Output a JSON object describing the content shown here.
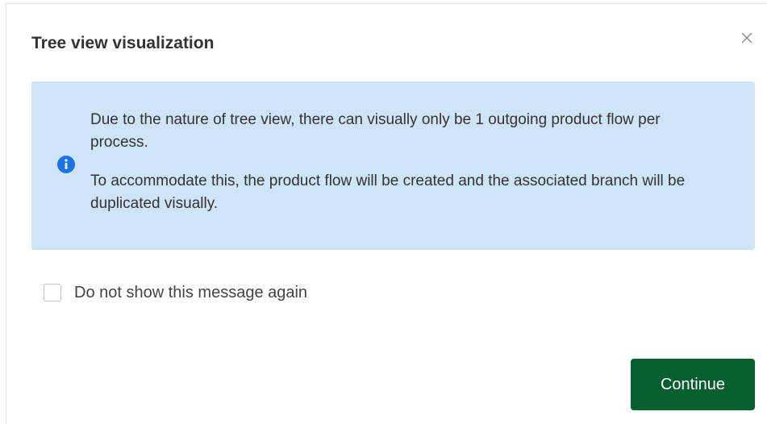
{
  "dialog": {
    "title": "Tree view visualization",
    "close_icon": "close-icon",
    "info": {
      "icon": "info-icon",
      "icon_color": "#1a73e8",
      "background_color": "#cfe4f7",
      "paragraph_1": "Due to the nature of tree view, there can visually only be 1 outgoing product flow per process.",
      "paragraph_2": "To accommodate this, the product flow will be created and the associated branch will be duplicated visually."
    },
    "checkbox": {
      "label": "Do not show this message again",
      "checked": false
    },
    "continue_button": {
      "label": "Continue",
      "color": "#075e2f"
    }
  }
}
